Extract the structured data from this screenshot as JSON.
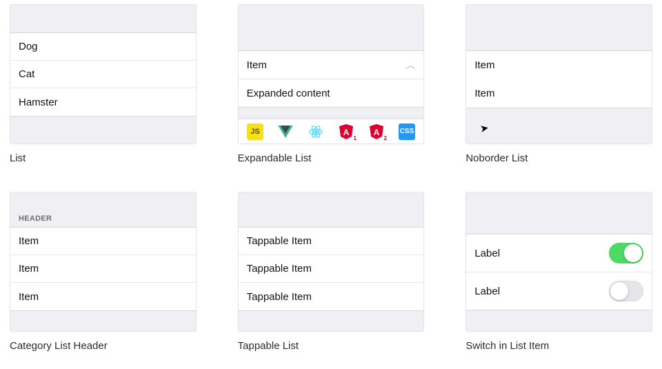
{
  "cards": {
    "c1": {
      "caption": "List",
      "items": [
        "Dog",
        "Cat",
        "Hamster"
      ]
    },
    "c2": {
      "caption": "Expandable List",
      "item_label": "Item",
      "expanded_label": "Expanded content",
      "toolbar_icons": [
        "js",
        "vue",
        "react",
        "angular1",
        "angular2",
        "css"
      ]
    },
    "c3": {
      "caption": "Noborder List",
      "items": [
        "Item",
        "Item"
      ]
    },
    "c4": {
      "caption": "Category List Header",
      "header": "HEADER",
      "items": [
        "Item",
        "Item",
        "Item"
      ]
    },
    "c5": {
      "caption": "Tappable List",
      "items": [
        "Tappable Item",
        "Tappable Item",
        "Tappable Item"
      ]
    },
    "c6": {
      "caption": "Switch in List Item",
      "rows": [
        {
          "label": "Label",
          "on": true
        },
        {
          "label": "Label",
          "on": false
        }
      ]
    }
  },
  "platform_icon": "apple"
}
